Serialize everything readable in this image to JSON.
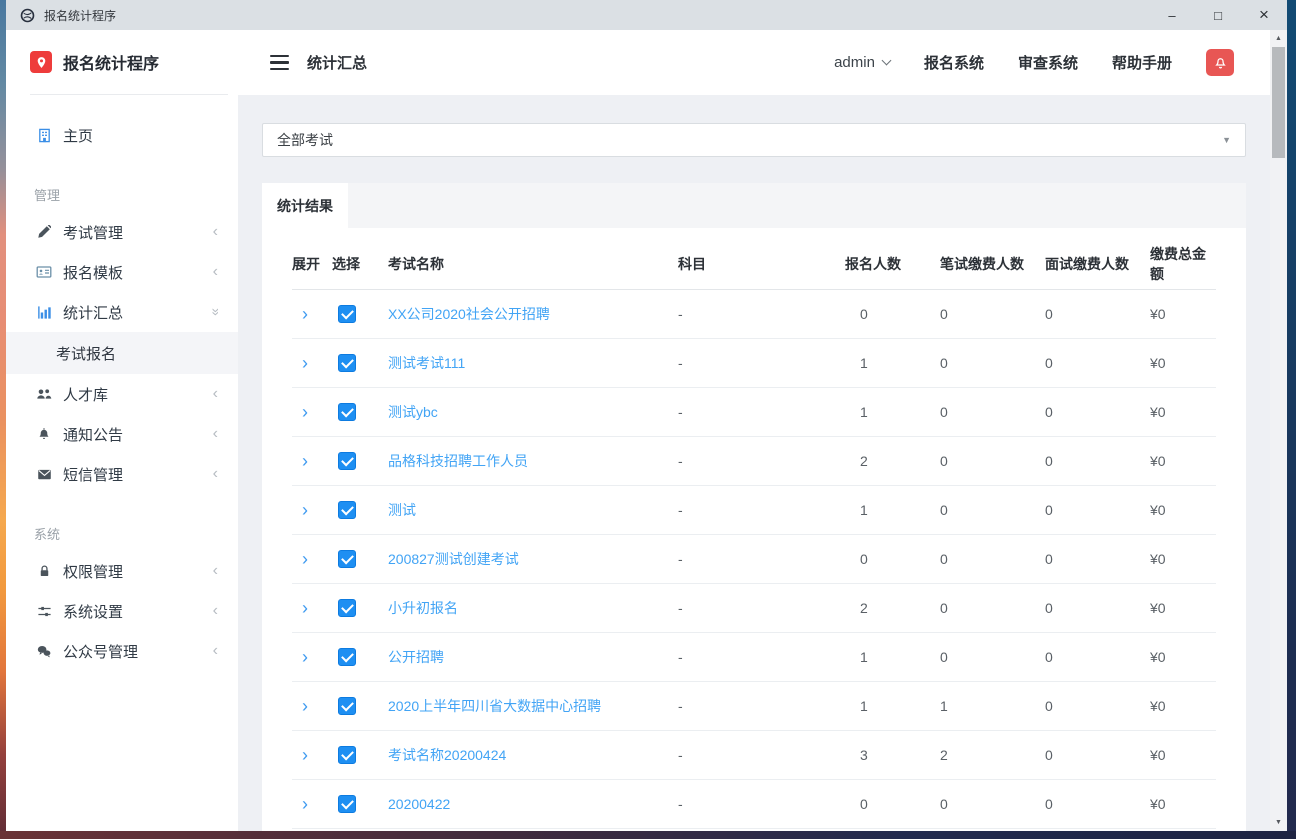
{
  "titlebar": {
    "title": "报名统计程序",
    "minimize": "–",
    "maximize": "□",
    "close": "×"
  },
  "sidebar": {
    "logo_text": "报名统计程序",
    "items": [
      {
        "label": "主页"
      },
      {
        "label": "管理"
      },
      {
        "label": "考试管理"
      },
      {
        "label": "报名模板"
      },
      {
        "label": "统计汇总"
      },
      {
        "label": "考试报名"
      },
      {
        "label": "人才库"
      },
      {
        "label": "通知公告"
      },
      {
        "label": "短信管理"
      },
      {
        "label": "系统"
      },
      {
        "label": "权限管理"
      },
      {
        "label": "系统设置"
      },
      {
        "label": "公众号管理"
      }
    ]
  },
  "header": {
    "page_title": "统计汇总",
    "user": "admin",
    "links": [
      "报名系统",
      "审查系统",
      "帮助手册"
    ]
  },
  "main": {
    "filter_value": "全部考试",
    "tab_label": "统计结果"
  },
  "table": {
    "columns": [
      "展开",
      "选择",
      "考试名称",
      "科目",
      "报名人数",
      "笔试缴费人数",
      "面试缴费人数",
      "缴费总金额"
    ],
    "rows": [
      {
        "name": "XX公司2020社会公开招聘",
        "subject": "-",
        "applicants": "0",
        "written_paid": "0",
        "interview_paid": "0",
        "total_fee": "¥0",
        "checked": true
      },
      {
        "name": "测试考试111",
        "subject": "-",
        "applicants": "1",
        "written_paid": "0",
        "interview_paid": "0",
        "total_fee": "¥0",
        "checked": true
      },
      {
        "name": "测试ybc",
        "subject": "-",
        "applicants": "1",
        "written_paid": "0",
        "interview_paid": "0",
        "total_fee": "¥0",
        "checked": true
      },
      {
        "name": "品格科技招聘工作人员",
        "subject": "-",
        "applicants": "2",
        "written_paid": "0",
        "interview_paid": "0",
        "total_fee": "¥0",
        "checked": true
      },
      {
        "name": "测试",
        "subject": "-",
        "applicants": "1",
        "written_paid": "0",
        "interview_paid": "0",
        "total_fee": "¥0",
        "checked": true
      },
      {
        "name": "200827测试创建考试",
        "subject": "-",
        "applicants": "0",
        "written_paid": "0",
        "interview_paid": "0",
        "total_fee": "¥0",
        "checked": true
      },
      {
        "name": "小升初报名",
        "subject": "-",
        "applicants": "2",
        "written_paid": "0",
        "interview_paid": "0",
        "total_fee": "¥0",
        "checked": true
      },
      {
        "name": "公开招聘",
        "subject": "-",
        "applicants": "1",
        "written_paid": "0",
        "interview_paid": "0",
        "total_fee": "¥0",
        "checked": true
      },
      {
        "name": "2020上半年四川省大数据中心招聘",
        "subject": "-",
        "applicants": "1",
        "written_paid": "1",
        "interview_paid": "0",
        "total_fee": "¥0",
        "checked": true
      },
      {
        "name": "考试名称20200424",
        "subject": "-",
        "applicants": "3",
        "written_paid": "2",
        "interview_paid": "0",
        "total_fee": "¥0",
        "checked": true
      },
      {
        "name": "20200422",
        "subject": "-",
        "applicants": "0",
        "written_paid": "0",
        "interview_paid": "0",
        "total_fee": "¥0",
        "checked": true
      }
    ]
  },
  "icons": {
    "expand_chevron": "›",
    "collapse_chevron": "‹",
    "expanded_chevron": "«",
    "select_caret": "▼",
    "scroll_up": "▲",
    "scroll_down": "▼"
  },
  "colors": {
    "accent_blue": "#1e8ff2",
    "link_blue": "#42a4f5",
    "brand_red": "#ee3c3b",
    "bell_red": "#e85654",
    "main_bg": "#eef0f4"
  }
}
